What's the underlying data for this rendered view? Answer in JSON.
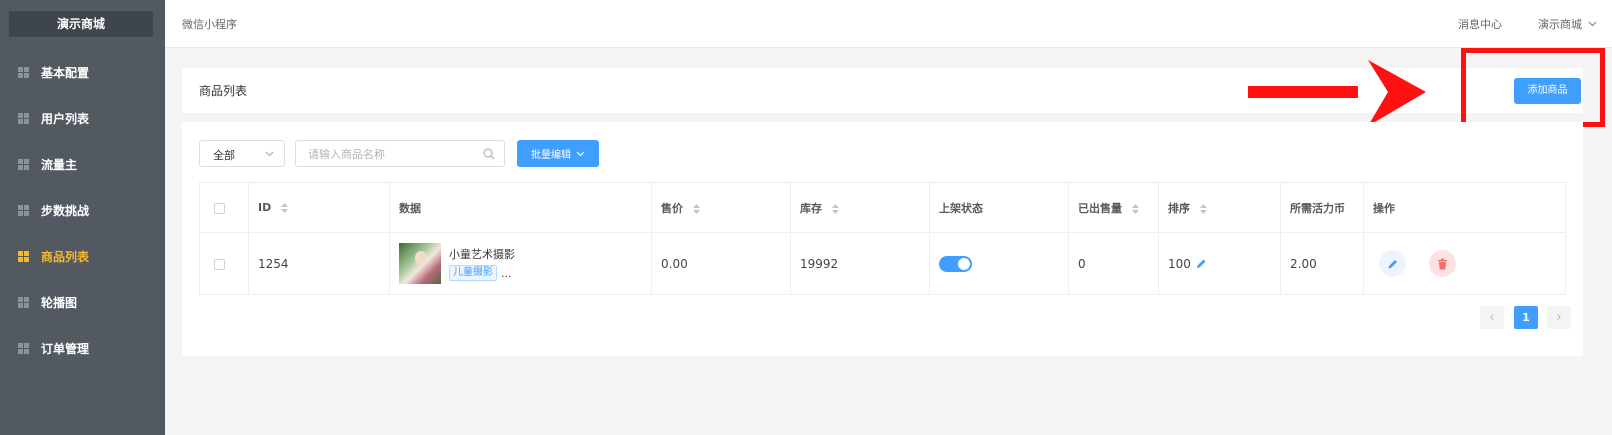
{
  "brand": "演示商城",
  "sidebar": {
    "items": [
      {
        "label": "基本配置",
        "active": false
      },
      {
        "label": "用户列表",
        "active": false
      },
      {
        "label": "流量主",
        "active": false
      },
      {
        "label": "步数挑战",
        "active": false
      },
      {
        "label": "商品列表",
        "active": true
      },
      {
        "label": "轮播图",
        "active": false
      },
      {
        "label": "订单管理",
        "active": false
      }
    ]
  },
  "header": {
    "title": "微信小程序",
    "message_center": "消息中心",
    "user_menu": "演示商城"
  },
  "page": {
    "title": "商品列表",
    "add_button": "添加商品"
  },
  "filters": {
    "category_selected": "全部",
    "search_placeholder": "请输入商品名称",
    "search_value": "",
    "batch_edit": "批量编辑"
  },
  "table": {
    "columns": [
      "ID",
      "数据",
      "售价",
      "库存",
      "上架状态",
      "已出售量",
      "排序",
      "所需活力币",
      "操作"
    ],
    "rows": [
      {
        "id": "1254",
        "name": "小童艺术摄影",
        "tag": "儿童摄影",
        "more": "...",
        "price": "0.00",
        "stock": "19992",
        "on_shelf": true,
        "sold": "0",
        "sort": "100",
        "coins": "2.00"
      }
    ]
  },
  "pagination": {
    "current_page": "1",
    "prev": "‹",
    "next": "›"
  },
  "colors": {
    "sidebar_bg": "#525960",
    "active": "#f7b82a",
    "primary": "#409eff",
    "danger": "#f56c6c",
    "annotation": "#ff1111"
  }
}
